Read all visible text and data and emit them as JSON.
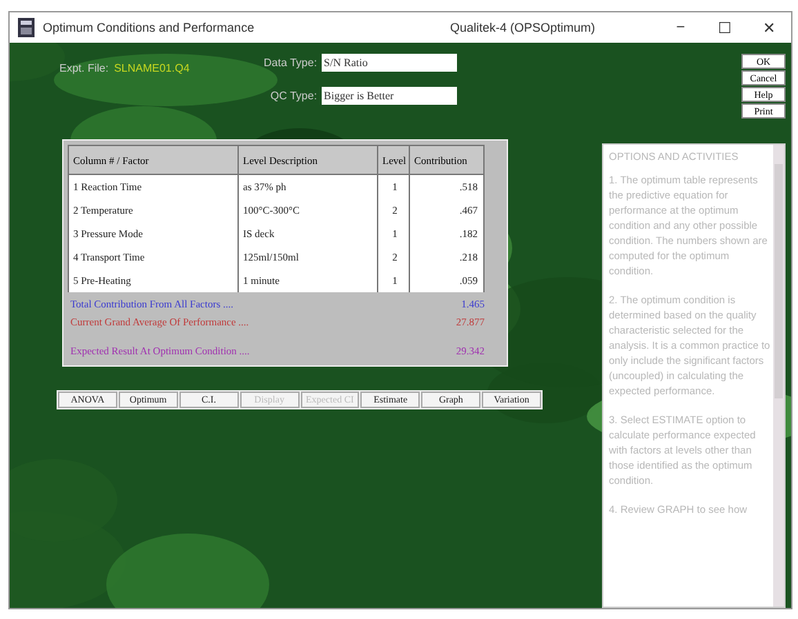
{
  "window": {
    "title": "Optimum Conditions and Performance",
    "subtitle": "Qualitek-4 (OPSOptimum)",
    "controls": [
      "−",
      "☐",
      "✕"
    ]
  },
  "header": {
    "file_label": "Expt. File:",
    "file_name": "SLNAME01.Q4",
    "data_type_label": "Data Type:",
    "data_type": "S/N Ratio",
    "qc_type_label": "QC Type:",
    "qc_type": "Bigger is Better"
  },
  "side_buttons": [
    "OK",
    "Cancel",
    "Help",
    "Print"
  ],
  "table": {
    "columns": [
      "Column # / Factor",
      "Level Description",
      "Level",
      "Contribution"
    ],
    "rows": [
      {
        "factor": "1 Reaction Time",
        "description": "as 37% ph",
        "level": "1",
        "contribution": ".518"
      },
      {
        "factor": "2 Temperature",
        "description": "100°C-300°C",
        "level": "2",
        "contribution": ".467"
      },
      {
        "factor": "3 Pressure Mode",
        "description": "IS deck",
        "level": "1",
        "contribution": ".182"
      },
      {
        "factor": "4 Transport Time",
        "description": "125ml/150ml",
        "level": "2",
        "contribution": ".218"
      },
      {
        "factor": "5 Pre-Heating",
        "description": "1 minute",
        "level": "1",
        "contribution": ".059"
      }
    ]
  },
  "summary": [
    {
      "label": "Total Contribution From All Factors ....",
      "value": "1.465",
      "color": "#3a3ad0"
    },
    {
      "label": "Current Grand Average Of Performance ....",
      "value": "27.877",
      "color": "#c03a3a"
    },
    {
      "label": "Expected Result At Optimum Condition ....",
      "value": "29.342",
      "color": "#a030b0"
    }
  ],
  "buttons": [
    {
      "label": "ANOVA",
      "disabled": false
    },
    {
      "label": "Optimum",
      "disabled": false
    },
    {
      "label": "C.I.",
      "disabled": false
    },
    {
      "label": "Display",
      "disabled": true
    },
    {
      "label": "Expected CI",
      "disabled": true
    },
    {
      "label": "Estimate",
      "disabled": false
    },
    {
      "label": "Graph",
      "disabled": false
    },
    {
      "label": "Variation",
      "disabled": false
    }
  ],
  "options": {
    "title": "OPTIONS AND ACTIVITIES",
    "paragraphs": [
      "1. The optimum table represents the predictive equation for performance at the optimum condition and any other possible condition. The numbers shown are computed for the optimum condition.",
      "2. The optimum condition is determined based on the quality characteristic selected for the analysis. It is a common practice to only include the significant factors (uncoupled) in calculating the expected performance.",
      "3. Select ESTIMATE option to calculate performance expected with factors at levels other than those identified as the optimum condition.",
      "4. Review GRAPH to see how"
    ]
  }
}
